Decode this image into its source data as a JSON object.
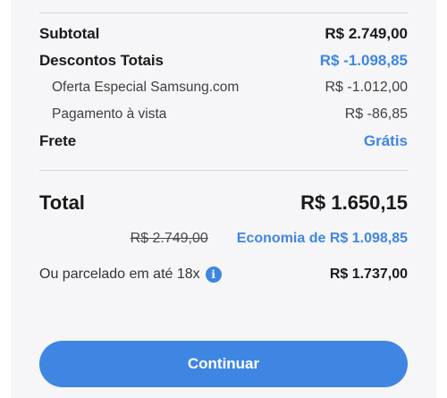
{
  "summary": {
    "subtotal_label": "Subtotal",
    "subtotal_value": "R$ 2.749,00",
    "discounts_label": "Descontos Totais",
    "discounts_value": "R$ -1.098,85",
    "offer_label": "Oferta Especial Samsung.com",
    "offer_value": "R$ -1.012,00",
    "cash_label": "Pagamento à vista",
    "cash_value": "R$ -86,85",
    "shipping_label": "Frete",
    "shipping_value": "Grátis"
  },
  "total": {
    "label": "Total",
    "value": "R$ 1.650,15",
    "original_price": "R$ 2.749,00",
    "economy_text": "Economia de R$ 1.098,85"
  },
  "installments": {
    "label": "Ou parcelado em até 18x",
    "info_icon": "i",
    "value": "R$ 1.737,00"
  },
  "actions": {
    "continue_label": "Continuar"
  },
  "colors": {
    "accent": "#3f86e3",
    "background": "#f6f6f8"
  }
}
